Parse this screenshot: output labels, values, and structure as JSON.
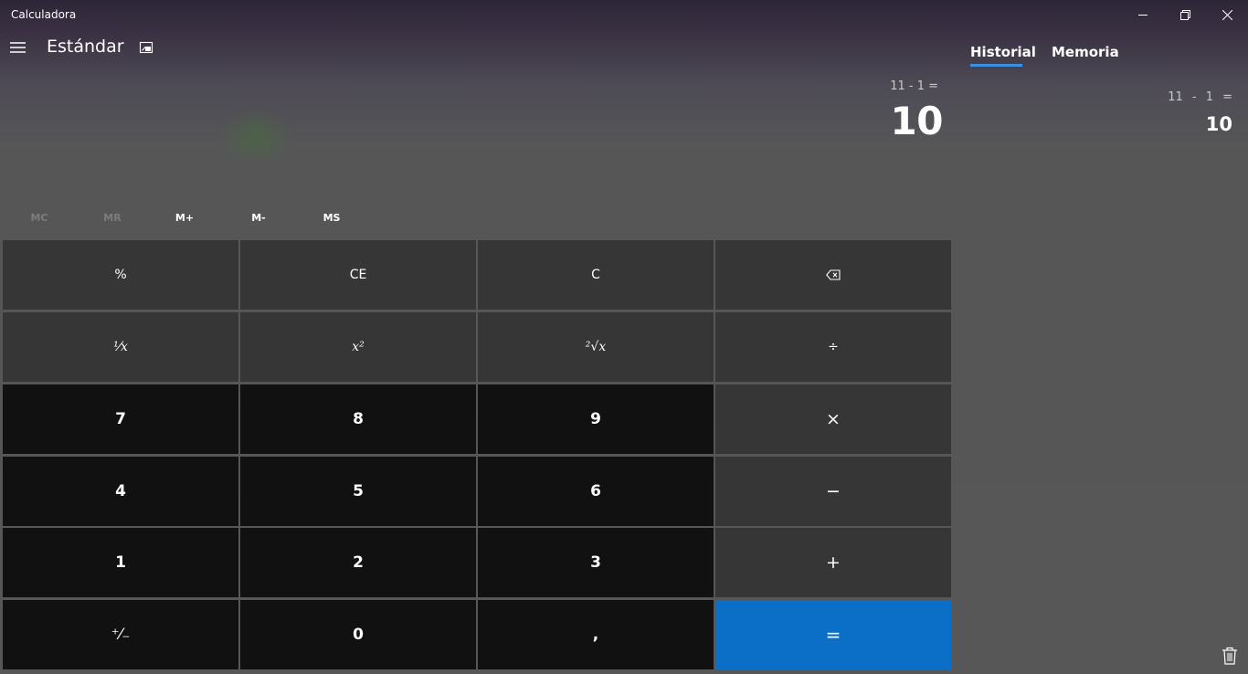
{
  "window": {
    "title": "Calculadora",
    "controls": [
      "minimize-icon",
      "restore-icon",
      "close-icon"
    ]
  },
  "header": {
    "menu_icon": "hamburger-icon",
    "mode_title": "Estándar",
    "overlay_icon": "keep-on-top-icon"
  },
  "display": {
    "expression": "11 - 1 =",
    "result": "10"
  },
  "memory": {
    "buttons": [
      {
        "label": "MC",
        "enabled": false
      },
      {
        "label": "MR",
        "enabled": false
      },
      {
        "label": "M+",
        "enabled": true
      },
      {
        "label": "M-",
        "enabled": true
      },
      {
        "label": "MS",
        "enabled": true
      }
    ]
  },
  "keypad": {
    "rows": [
      [
        "%",
        "CE",
        "C",
        "⌫"
      ],
      [
        "¹⁄x",
        "x²",
        "²√x",
        "÷"
      ],
      [
        "7",
        "8",
        "9",
        "×"
      ],
      [
        "4",
        "5",
        "6",
        "−"
      ],
      [
        "1",
        "2",
        "3",
        "+"
      ],
      [
        "⁺⁄₋",
        "0",
        ",",
        "="
      ]
    ]
  },
  "side_panel": {
    "tabs": [
      {
        "label": "Historial",
        "active": true
      },
      {
        "label": "Memoria",
        "active": false
      }
    ],
    "history": [
      {
        "expression": "11 - 1 =",
        "result": "10"
      }
    ],
    "trash_icon": "trash-icon"
  },
  "colors": {
    "accent": "#0b6fc7",
    "function_key": "#363636",
    "number_key": "#111111"
  }
}
